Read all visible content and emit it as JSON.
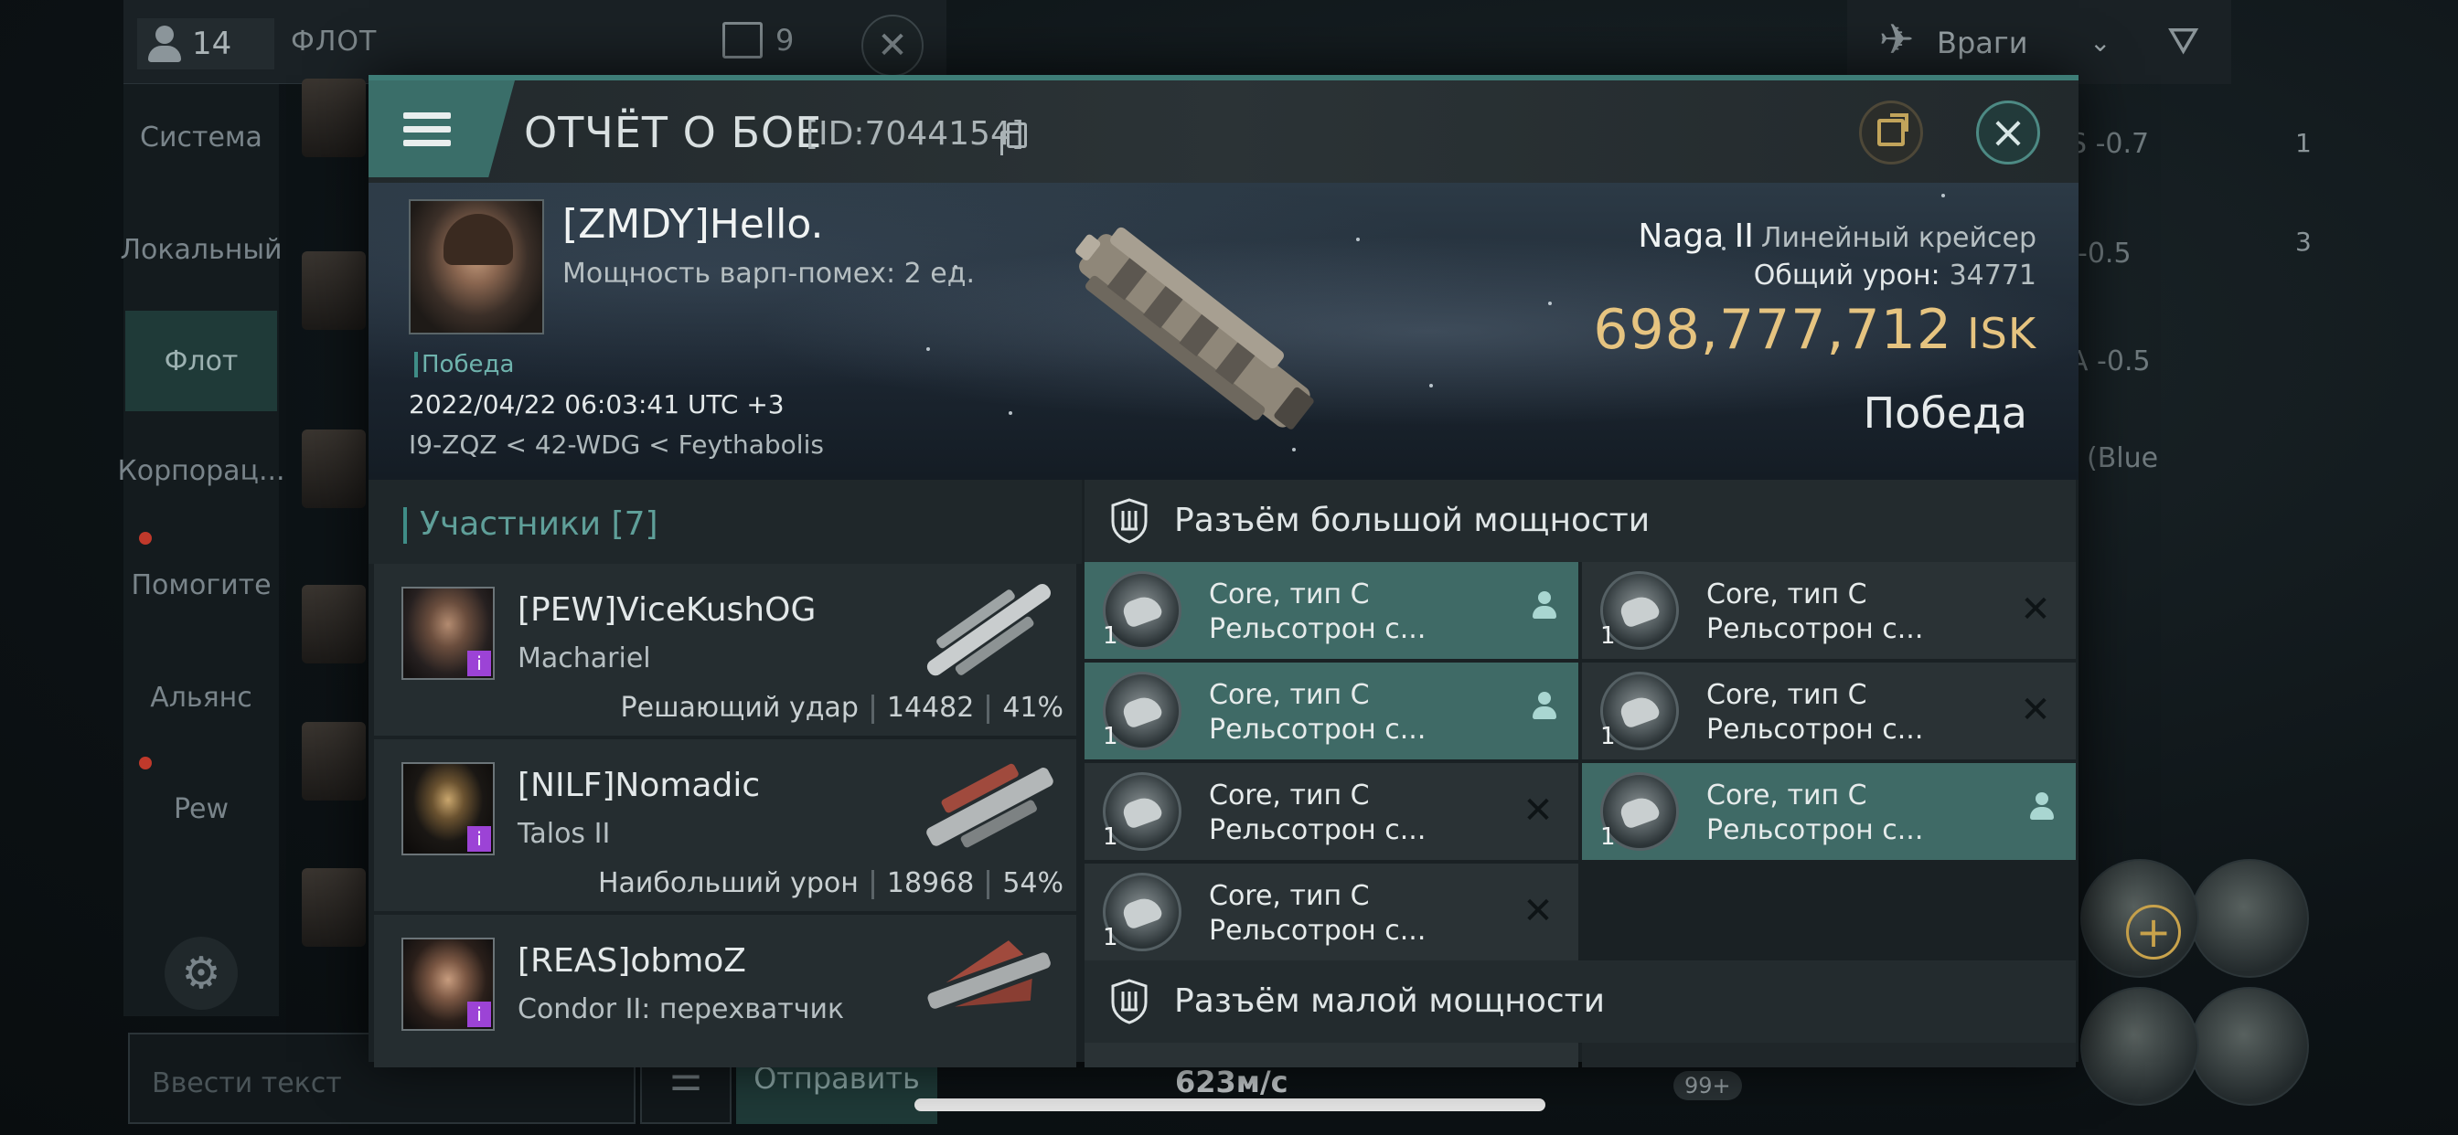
{
  "background": {
    "member_count": "14",
    "fleet_title": "ФЛОТ",
    "screens_count": "9",
    "close_glyph": "✕",
    "sidebar": [
      {
        "label": "Система"
      },
      {
        "label": "Локальный"
      },
      {
        "label": "Флот"
      },
      {
        "label": "Корпорац..."
      },
      {
        "label": "Помогите"
      },
      {
        "label": "Альянс"
      },
      {
        "label": "Pew"
      }
    ],
    "input_placeholder": "Ввести текст",
    "send_label": "Отправить",
    "speed": "623м/с",
    "enemy_filter": "Враги",
    "right_texts": [
      "S -0.7",
      "-0.5",
      "A -0.5",
      "(Blue"
    ],
    "right_counts": [
      "1",
      "3"
    ],
    "badge": "99+"
  },
  "report": {
    "title": "ОТЧЁТ О БОЕ",
    "id": "[ID:7044154]",
    "pilot_name": "[ZMDY]Hello.",
    "warp_disruption": "Мощность варп-помех: 2 ед.",
    "outcome_tag": "Победа",
    "datetime": "2022/04/22 06:03:41 UTC +3",
    "location": "I9-ZQZ < 42-WDG < Feythabolis",
    "ship_name": "Naga II",
    "ship_class": "Линейный крейсер",
    "total_damage_label": "Общий урон:",
    "total_damage": "34771",
    "isk_value": "698,777,712",
    "isk_unit": "ISK",
    "result": "Победа",
    "colors": {
      "accent": "#3f8d87",
      "isk": "#e6c480",
      "slot_active": "#3f6a66"
    }
  },
  "participants": {
    "label": "Участники [7]",
    "items": [
      {
        "name": "[PEW]ViceKushOG",
        "ship": "Machariel",
        "role": "Решающий удар",
        "damage": "14482",
        "percent": "41%"
      },
      {
        "name": "[NILF]Nomadic",
        "ship": "Talos II",
        "role": "Наибольший урон",
        "damage": "18968",
        "percent": "54%"
      },
      {
        "name": "[REAS]obmoZ",
        "ship": "Condor II: перехватчик",
        "role": "",
        "damage": "",
        "percent": ""
      }
    ]
  },
  "high_slots": {
    "title": "Разъём большой мощности",
    "items": [
      {
        "qty": "1",
        "line1": "Core, тип C",
        "line2": "Рельсотрон с...",
        "state": "user-icon"
      },
      {
        "qty": "1",
        "line1": "Core, тип C",
        "line2": "Рельсотрон с...",
        "state": "destroyed-x-icon"
      },
      {
        "qty": "1",
        "line1": "Core, тип C",
        "line2": "Рельсотрон с...",
        "state": "user-icon"
      },
      {
        "qty": "1",
        "line1": "Core, тип C",
        "line2": "Рельсотрон с...",
        "state": "destroyed-x-icon"
      },
      {
        "qty": "1",
        "line1": "Core, тип C",
        "line2": "Рельсотрон с...",
        "state": "destroyed-x-icon"
      },
      {
        "qty": "1",
        "line1": "Core, тип C",
        "line2": "Рельсотрон с...",
        "state": "user-icon"
      },
      {
        "qty": "1",
        "line1": "Core, тип C",
        "line2": "Рельсотрон с...",
        "state": "destroyed-x-icon"
      }
    ]
  },
  "low_slots": {
    "title": "Разъём малой мощности"
  }
}
